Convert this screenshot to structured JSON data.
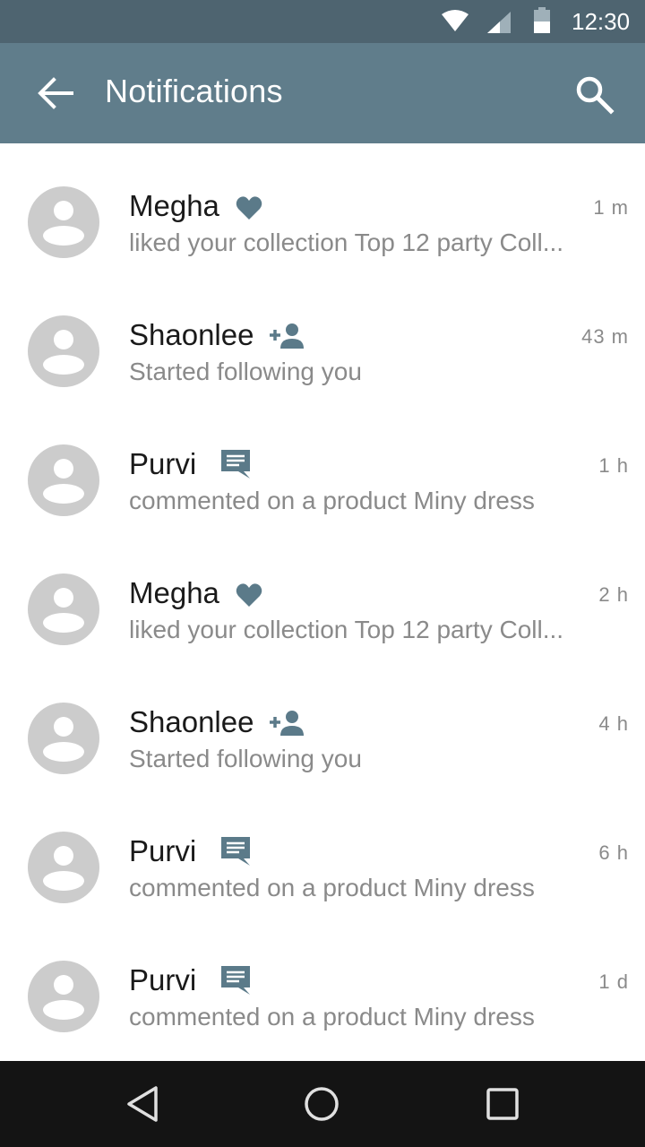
{
  "status_bar": {
    "time": "12:30",
    "icons": [
      "wifi-icon",
      "cell-signal-icon",
      "battery-icon"
    ]
  },
  "app_bar": {
    "title": "Notifications",
    "icons": [
      "back-arrow-icon",
      "search-icon"
    ],
    "background_color": "#607d8b"
  },
  "notifications": [
    {
      "name": "Megha",
      "icon": "heart-icon",
      "text": "liked your collection Top 12 party Coll...",
      "time": "1 m"
    },
    {
      "name": "Shaonlee",
      "icon": "person-add-icon",
      "text": "Started following you",
      "time": "43 m"
    },
    {
      "name": "Purvi",
      "icon": "comment-icon",
      "text": "commented on a product Miny dress",
      "time": "1 h"
    },
    {
      "name": "Megha",
      "icon": "heart-icon",
      "text": "liked your collection Top 12 party Coll...",
      "time": "2 h"
    },
    {
      "name": "Shaonlee",
      "icon": "person-add-icon",
      "text": "Started following you",
      "time": "4 h"
    },
    {
      "name": "Purvi",
      "icon": "comment-icon",
      "text": "commented on a product Miny dress",
      "time": "6 h"
    },
    {
      "name": "Purvi",
      "icon": "comment-icon",
      "text": "commented on a product Miny dress",
      "time": "1 d"
    }
  ],
  "nav_bar": {
    "icons": [
      "back-triangle-icon",
      "home-circle-icon",
      "recents-square-icon"
    ]
  },
  "colors": {
    "accent_icon": "#5b7a89",
    "avatar": "#cccccc",
    "secondary_text": "#8a8a8a"
  }
}
